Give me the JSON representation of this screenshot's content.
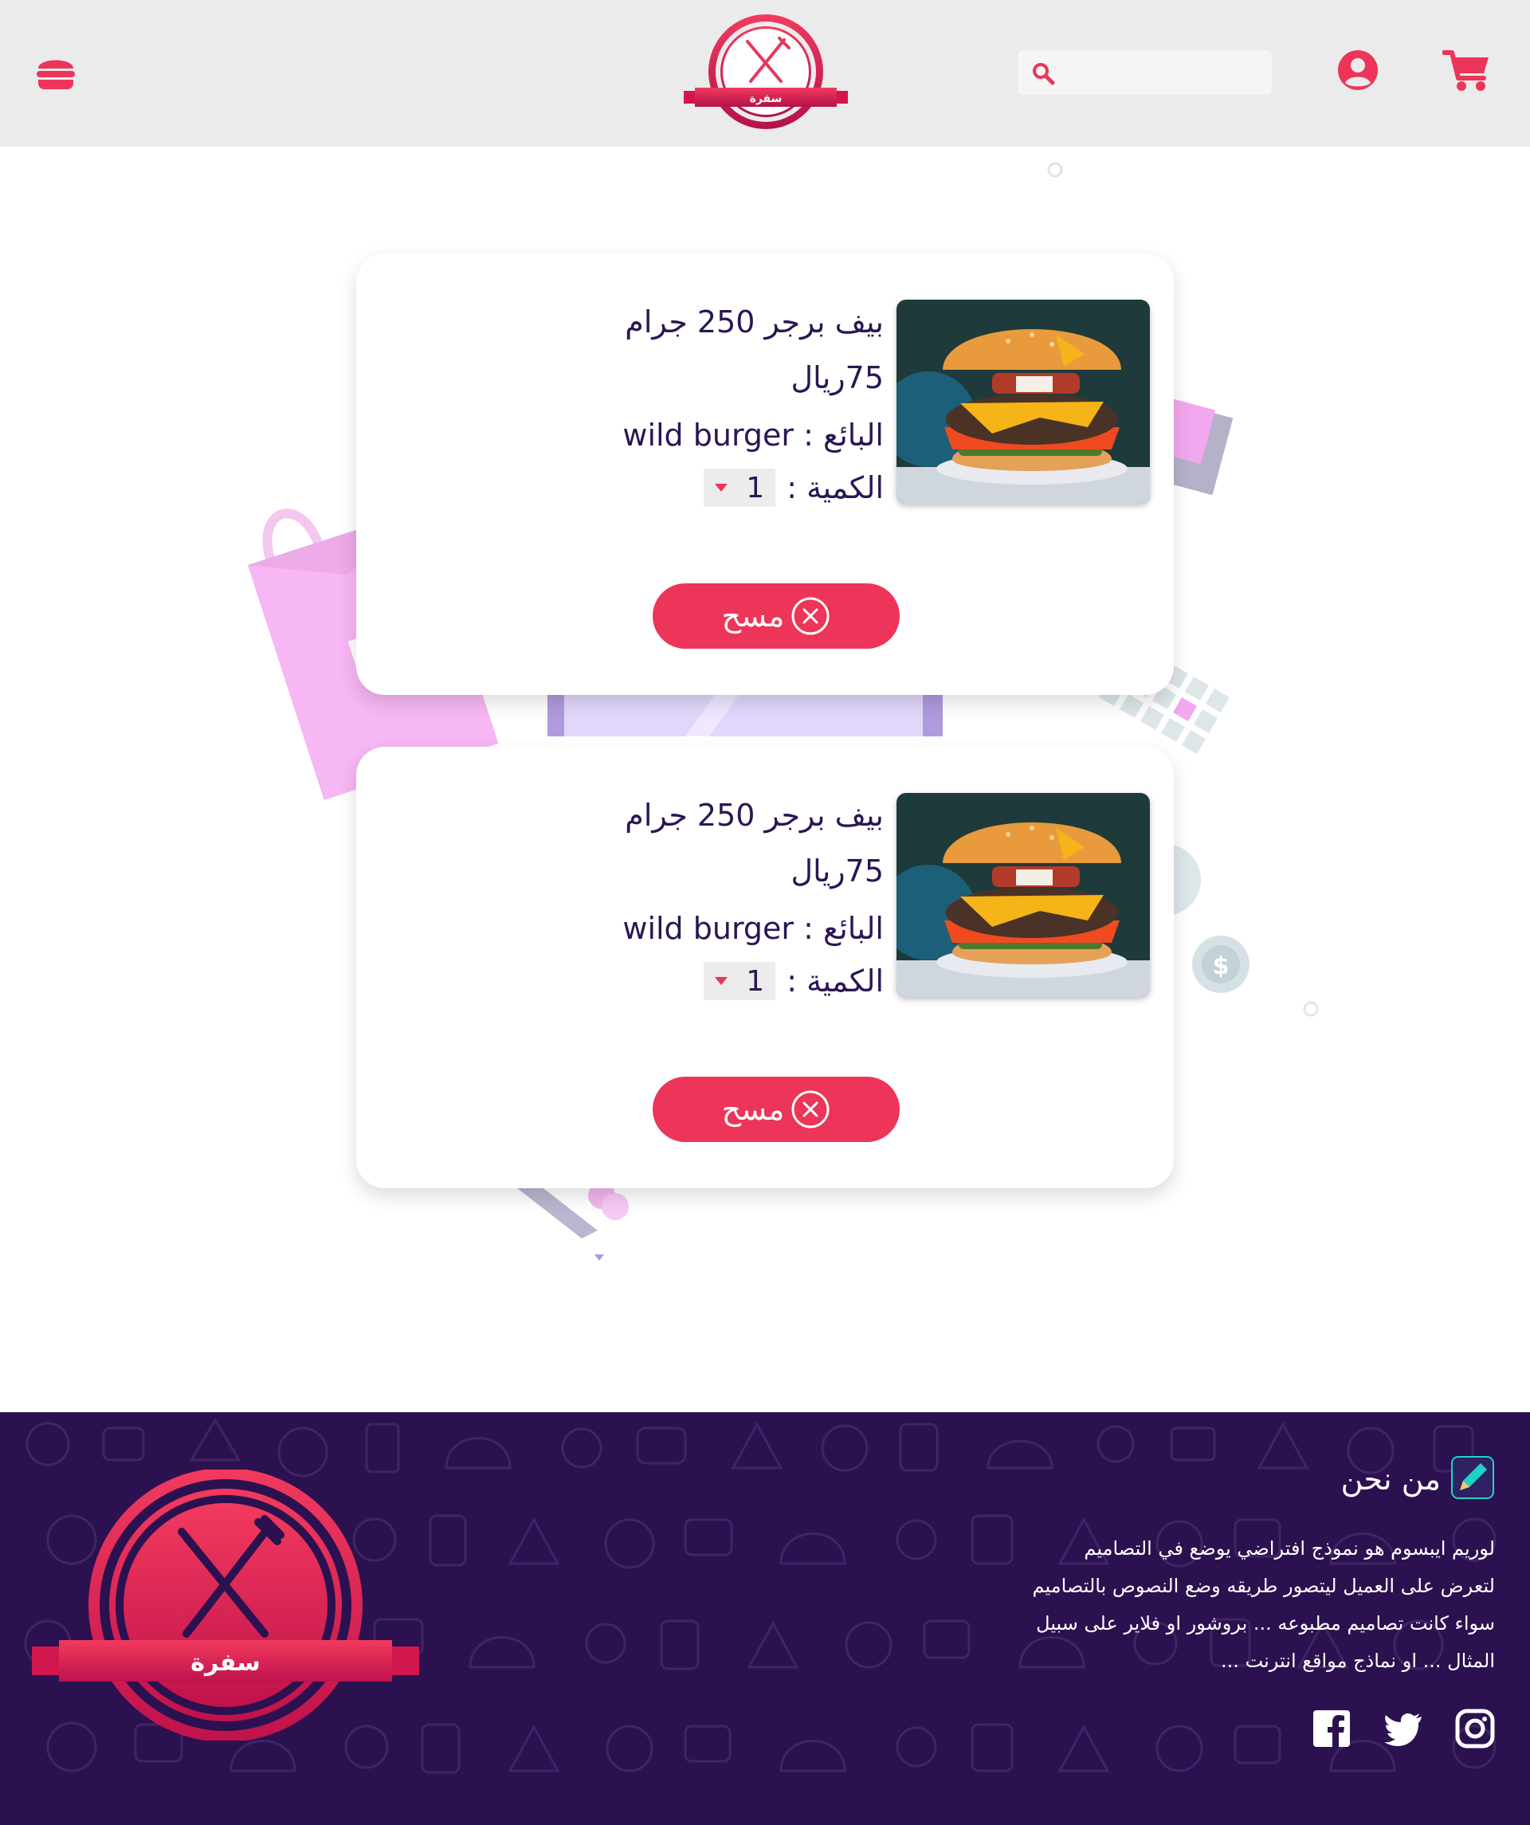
{
  "header": {
    "logo_text": "سفرة",
    "search_placeholder": "",
    "icons": [
      "burger-menu-icon",
      "search-icon",
      "user-circle-icon",
      "shopping-cart-icon"
    ]
  },
  "cart": {
    "items": [
      {
        "name": "بيف برجر 250 جرام",
        "price": "75ريال",
        "seller": "البائع : wild burger",
        "quantity_label": "الكمية :",
        "quantity": "1",
        "delete_label": "مسح"
      },
      {
        "name": "بيف برجر 250 جرام",
        "price": "75ريال",
        "seller": "البائع : wild burger",
        "quantity_label": "الكمية :",
        "quantity": "1",
        "delete_label": "مسح"
      }
    ]
  },
  "footer": {
    "logo_text": "سفرة",
    "about_title": "من نحن",
    "about_lines": [
      "لوريم ايبسوم هو نموذج افتراضي يوضع في التصاميم",
      "لتعرض على العميل ليتصور طريقه وضع النصوص بالتصاميم",
      "سواء كانت تصاميم مطبوعه ... بروشور او فلاير على سبيل",
      "المثال ... او نماذج مواقع انترنت ..."
    ],
    "social": [
      "instagram-icon",
      "twitter-icon",
      "facebook-icon"
    ]
  },
  "colors": {
    "accent": "#ec3558",
    "header_bg": "#ebebeb",
    "footer_bg": "#2b1150",
    "text_dark": "#2b1654"
  }
}
